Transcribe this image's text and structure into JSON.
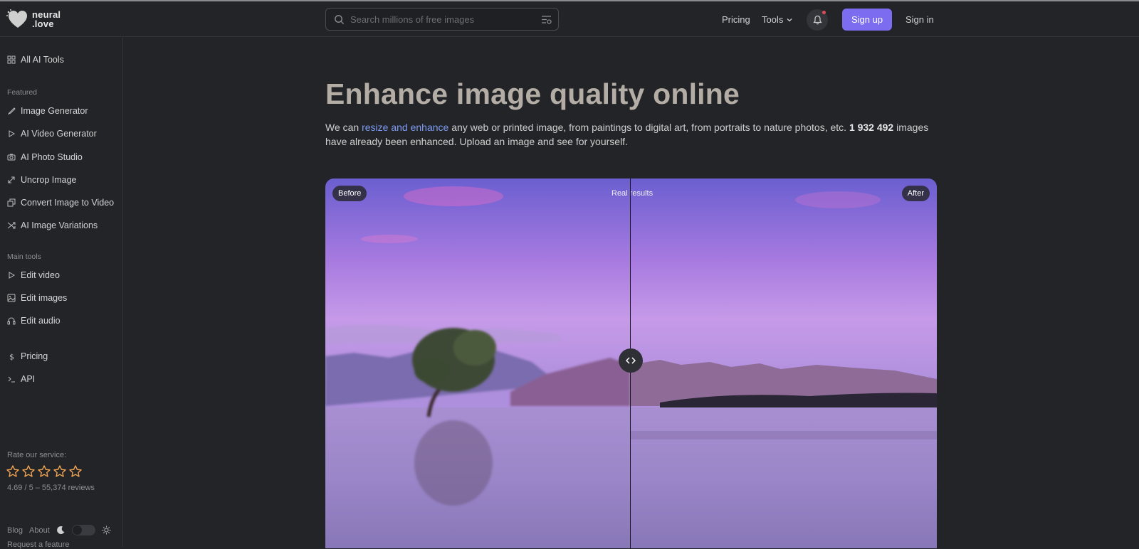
{
  "brand": {
    "name_line1": "neural",
    "name_line2": ".love"
  },
  "header": {
    "search_placeholder": "Search millions of free images",
    "pricing": "Pricing",
    "tools": "Tools",
    "sign_up": "Sign up",
    "sign_in": "Sign in",
    "accent": "#7b6cf0"
  },
  "sidebar": {
    "all_tools": "All AI Tools",
    "featured_heading": "Featured",
    "featured": [
      {
        "label": "Image Generator",
        "icon": "brush-icon"
      },
      {
        "label": "AI Video Generator",
        "icon": "play-icon"
      },
      {
        "label": "AI Photo Studio",
        "icon": "camera-icon"
      },
      {
        "label": "Uncrop Image",
        "icon": "expand-icon"
      },
      {
        "label": "Convert Image to Video",
        "icon": "layers-icon"
      },
      {
        "label": "AI Image Variations",
        "icon": "shuffle-icon"
      }
    ],
    "main_heading": "Main tools",
    "main": [
      {
        "label": "Edit video",
        "icon": "play-icon"
      },
      {
        "label": "Edit images",
        "icon": "image-icon"
      },
      {
        "label": "Edit audio",
        "icon": "headphones-icon"
      }
    ],
    "extra": [
      {
        "label": "Pricing",
        "icon": "dollar-icon"
      },
      {
        "label": "API",
        "icon": "terminal-icon"
      }
    ],
    "rate_label": "Rate our service:",
    "stars": 5,
    "rating_text": "4.69 / 5 – 55,374 reviews",
    "blog": "Blog",
    "about": "About",
    "request": "Request a feature",
    "star_color": "#f0a452"
  },
  "main": {
    "title": "Enhance image quality online",
    "intro_pre": "We can ",
    "intro_link": "resize and enhance",
    "intro_mid": " any web or printed image, from paintings to digital art, from portraits to nature photos, etc. ",
    "intro_count": "1 932 492",
    "intro_post": " images have already been enhanced. Upload an image and see for yourself.",
    "before": "Before",
    "after": "After",
    "real_results": "Real results"
  }
}
